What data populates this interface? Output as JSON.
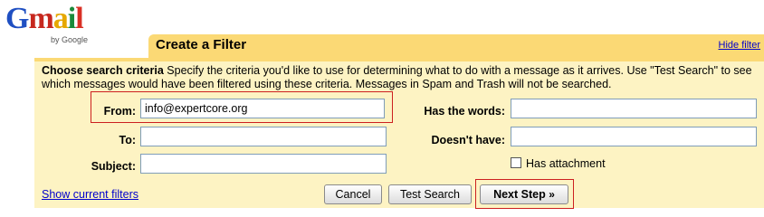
{
  "logo": {
    "letters": [
      "G",
      "m",
      "a",
      "i",
      "l"
    ],
    "by_google": "by Google"
  },
  "header": {
    "title": "Create a Filter",
    "hide_link": "Hide filter"
  },
  "criteria": {
    "heading": "Choose search criteria",
    "description": "Specify the criteria you'd like to use for determining what to do with a message as it arrives. Use \"Test Search\" to see which messages would have been filtered using these criteria. Messages in Spam and Trash will not be searched."
  },
  "fields": {
    "from_label": "From:",
    "from_value": "info@expertcore.org",
    "to_label": "To:",
    "to_value": "",
    "subject_label": "Subject:",
    "subject_value": "",
    "has_words_label": "Has the words:",
    "has_words_value": "",
    "doesnt_have_label": "Doesn't have:",
    "doesnt_have_value": "",
    "has_attachment_label": "Has attachment",
    "has_attachment_checked": false
  },
  "footer": {
    "show_filters": "Show current filters",
    "cancel": "Cancel",
    "test_search": "Test Search",
    "next_step": "Next Step",
    "next_step_chevron": "»"
  },
  "colors": {
    "tab": "#fbd975",
    "panel": "#fdf3c3",
    "link": "#0000cc",
    "highlight": "#cc2020"
  }
}
